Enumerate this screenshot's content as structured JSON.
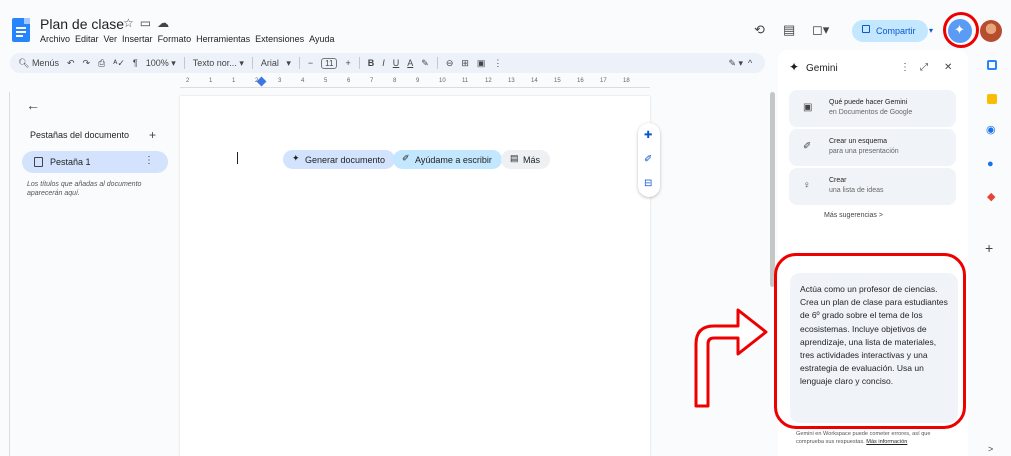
{
  "doc": {
    "title": "Plan de clase",
    "title_icons": [
      "star-icon",
      "folder-icon",
      "cloud-icon"
    ]
  },
  "menu": [
    "Archivo",
    "Editar",
    "Ver",
    "Insertar",
    "Formato",
    "Herramientas",
    "Extensiones",
    "Ayuda"
  ],
  "header": {
    "share_label": "Compartir",
    "icons": [
      "history-icon",
      "comments-icon",
      "meet-icon",
      "gemini-icon",
      "avatar"
    ]
  },
  "toolbar": {
    "search_label": "Menús",
    "zoom": "100%",
    "style": "Texto nor...",
    "font": "Arial",
    "font_size": "11",
    "bold": "B",
    "italic": "I",
    "underline": "U",
    "text_color": "A"
  },
  "ruler": {
    "marks": [
      "2",
      "1",
      "1",
      "2",
      "3",
      "4",
      "5",
      "6",
      "7",
      "8",
      "9",
      "10",
      "11",
      "12",
      "13",
      "14",
      "15",
      "16",
      "17",
      "18"
    ]
  },
  "sidebar": {
    "title": "Pestañas del documento",
    "add": "+",
    "tab_label": "Pestaña 1",
    "hint": "Los títulos que añadas al documento aparecerán aquí."
  },
  "chips": {
    "generate": "Generar documento",
    "help_write": "Ayúdame a escribir",
    "more": "Más"
  },
  "gemini": {
    "title": "Gemini",
    "suggestions": [
      {
        "title": "Qué puede hacer Gemini",
        "subtitle": "en Documentos de Google"
      },
      {
        "title": "Crear un esquema",
        "subtitle": "para una presentación"
      },
      {
        "title": "Crear",
        "subtitle": "una lista de ideas"
      }
    ],
    "more_suggestions": "Más sugerencias  >",
    "prompt": "Actúa como un profesor de ciencias. Crea un plan de clase para estudiantes de 6º grado sobre el tema de los ecosistemas. Incluye objetivos de aprendizaje, una lista de materiales, tres actividades interactivas y una estrategia de evaluación. Usa un lenguaje claro y conciso.",
    "disclaimer": "Gemini en Workspace puede cometer errores, así que comprueba sus respuestas.",
    "disclaimer_link": "Más información"
  },
  "colors": {
    "accent": "#0b57d0",
    "share_bg": "#c2e7ff",
    "annotation": "#ee0000",
    "panel_bg": "#f0f4f9"
  }
}
